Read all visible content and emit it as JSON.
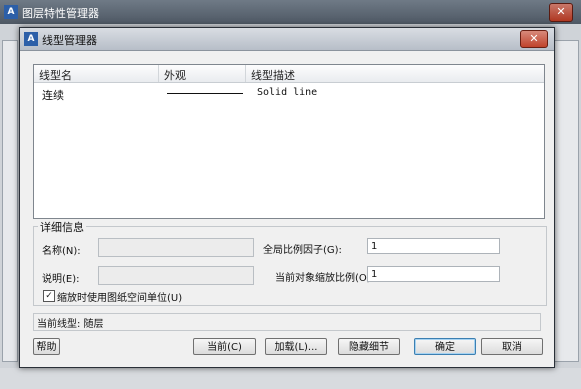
{
  "background_window": {
    "title": "图层特性管理器",
    "close_label": "✕"
  },
  "dialog": {
    "title": "线型管理器",
    "close_label": "✕",
    "columns": [
      "线型名",
      "外观",
      "线型描述"
    ],
    "rows": [
      {
        "name": "连续",
        "description": "Solid line"
      }
    ],
    "details": {
      "group_title": "详细信息",
      "name_label": "名称(N):",
      "description_label": "说明(E):",
      "global_scale_label": "全局比例因子(G):",
      "global_scale_value": "1",
      "current_scale_label": "当前对象缩放比例(O):",
      "current_scale_value": "1",
      "checkbox_label": "缩放时使用图纸空间单位(U)",
      "checkbox_mark": "✓"
    },
    "current_linetype": "当前线型: 随层",
    "buttons": {
      "help": "帮助",
      "current": "当前(C)",
      "load": "加载(L)...",
      "hide_details": "隐藏细节",
      "ok": "确定",
      "cancel": "取消"
    }
  }
}
